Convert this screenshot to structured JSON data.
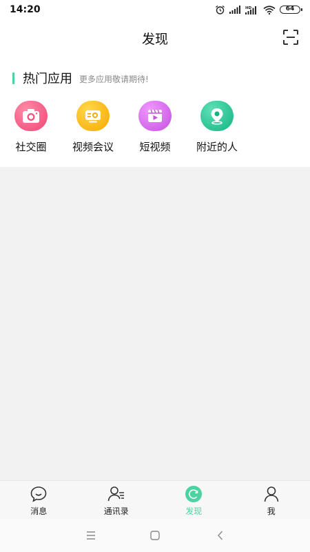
{
  "status_bar": {
    "time": "14:20",
    "battery": "64"
  },
  "header": {
    "title": "发现",
    "scan_icon": "scan-icon"
  },
  "hot_apps": {
    "title": "热门应用",
    "subtitle": "更多应用敬请期待!",
    "items": [
      {
        "label": "社交圈",
        "icon": "camera-icon",
        "color": "#f0527e"
      },
      {
        "label": "视频会议",
        "icon": "video-conference-icon",
        "color": "#fbb70f"
      },
      {
        "label": "短视频",
        "icon": "short-video-icon",
        "color": "#d466e6"
      },
      {
        "label": "附近的人",
        "icon": "location-pin-icon",
        "color": "#25c596"
      }
    ]
  },
  "tabs": [
    {
      "label": "消息",
      "icon": "chat-bubble-icon",
      "active": false
    },
    {
      "label": "通讯录",
      "icon": "contacts-icon",
      "active": false
    },
    {
      "label": "发现",
      "icon": "discover-icon",
      "active": true
    },
    {
      "label": "我",
      "icon": "user-icon",
      "active": false
    }
  ],
  "colors": {
    "accent": "#4cd3a2"
  }
}
